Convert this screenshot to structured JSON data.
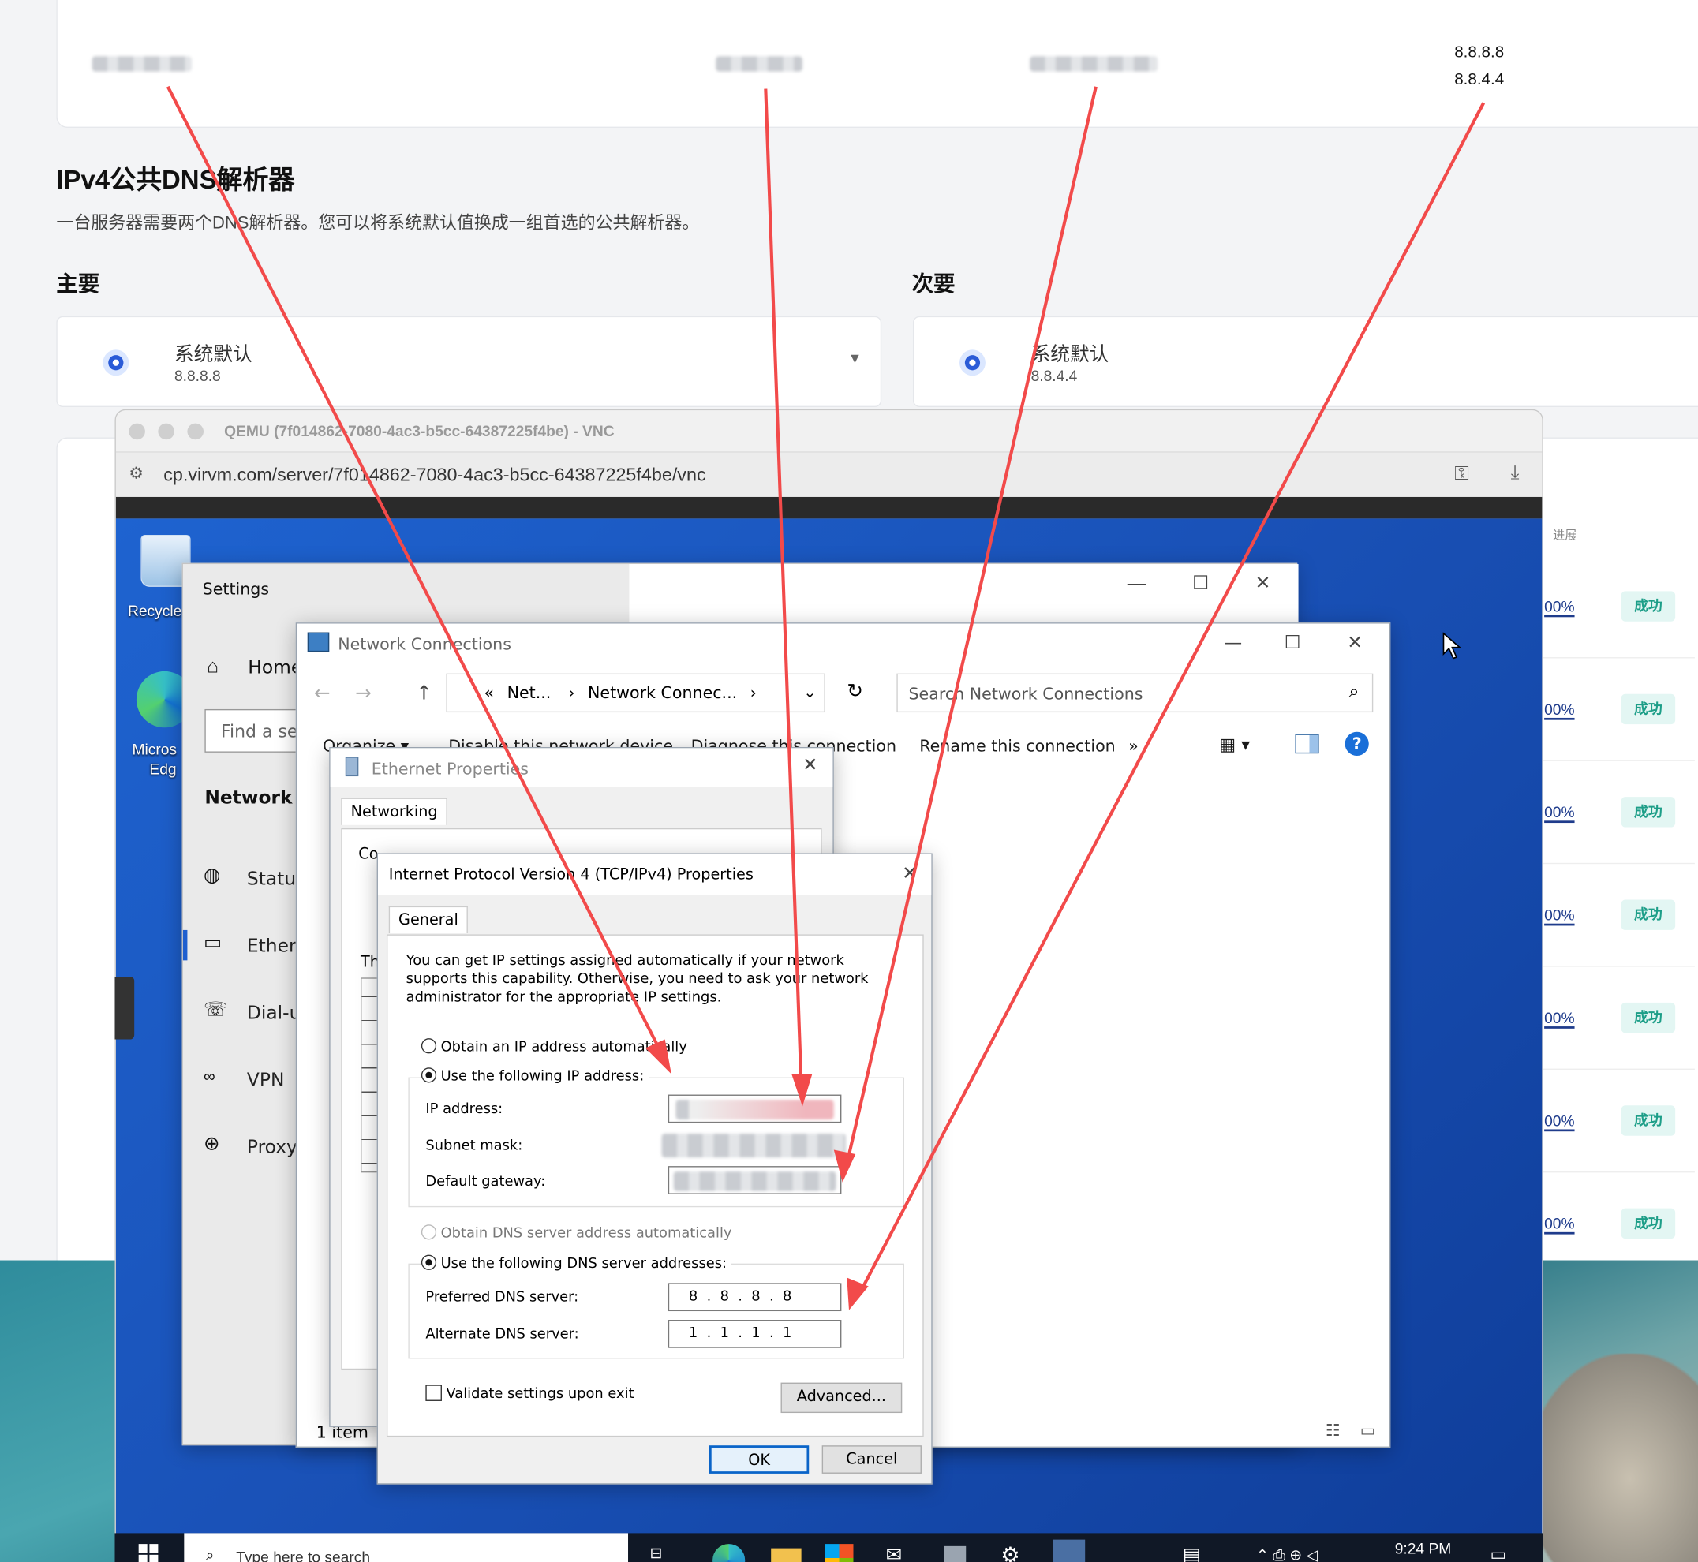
{
  "top_card": {
    "dns_values": [
      "8.8.8.8",
      "8.8.4.4"
    ]
  },
  "section": {
    "title": "IPv4公共DNS解析器",
    "description": "一台服务器需要两个DNS解析器。您可以将系统默认值换成一组首选的公共解析器。",
    "primary_label": "主要",
    "secondary_label": "次要",
    "primary": {
      "name": "系统默认",
      "value": "8.8.8.8"
    },
    "secondary": {
      "name": "系统默认",
      "value": "8.8.4.4"
    }
  },
  "right_table": {
    "header": "进展",
    "rows": [
      {
        "progress": "00%",
        "status": "成功"
      },
      {
        "progress": "00%",
        "status": "成功"
      },
      {
        "progress": "00%",
        "status": "成功"
      },
      {
        "progress": "00%",
        "status": "成功"
      },
      {
        "progress": "00%",
        "status": "成功"
      },
      {
        "progress": "00%",
        "status": "成功"
      },
      {
        "progress": "00%",
        "status": "成功"
      }
    ]
  },
  "browser": {
    "title": "QEMU (7f014862-7080-4ac3-b5cc-64387225f4be) - VNC",
    "url": "cp.virvm.com/server/7f014862-7080-4ac3-b5cc-64387225f4be/vnc"
  },
  "desktop": {
    "icons": [
      "Recycle",
      "Micros",
      "Edg"
    ]
  },
  "settings": {
    "title": "Settings",
    "home": "Home",
    "search_placeholder": "Find a se",
    "section": "Network &",
    "nav": [
      "Status",
      "Ethern",
      "Dial-u",
      "VPN",
      "Proxy"
    ]
  },
  "netconn": {
    "title": "Network Connections",
    "breadcrumb": [
      "«",
      "Net...",
      "›",
      "Network Connec...",
      "›"
    ],
    "search_placeholder": "Search Network Connections",
    "toolbar": [
      "Organize ▾",
      "Disable this network device",
      "Diagnose this connection",
      "Rename this connection",
      "»"
    ],
    "status": "1 item"
  },
  "ethprops": {
    "title": "Ethernet Properties",
    "tab": "Networking",
    "connect_label": "Co",
    "this_label": "Th"
  },
  "ipv4": {
    "title": "Internet Protocol Version 4 (TCP/IPv4) Properties",
    "tab": "General",
    "intro": "You can get IP settings assigned automatically if your network supports this capability. Otherwise, you need to ask your network administrator for the appropriate IP settings.",
    "obtain_ip": "Obtain an IP address automatically",
    "use_ip": "Use the following IP address:",
    "ip_label": "IP address:",
    "mask_label": "Subnet mask:",
    "gateway_label": "Default gateway:",
    "obtain_dns": "Obtain DNS server address automatically",
    "use_dns": "Use the following DNS server addresses:",
    "preferred_label": "Preferred DNS server:",
    "alternate_label": "Alternate DNS server:",
    "preferred_value": "8  .  8  .  8  .  8",
    "alternate_value": "1  .  1  .  1  .  1",
    "validate": "Validate settings upon exit",
    "advanced": "Advanced...",
    "ok": "OK",
    "cancel": "Cancel"
  },
  "taskbar": {
    "search_placeholder": "Type here to search",
    "time": "9:24 PM"
  },
  "colors": {
    "accent": "#1f3c8c",
    "success_bg": "#e3f6f3",
    "success_fg": "#1d9e88",
    "arrow": "#f24a4a",
    "desktop": "#1565c0"
  }
}
